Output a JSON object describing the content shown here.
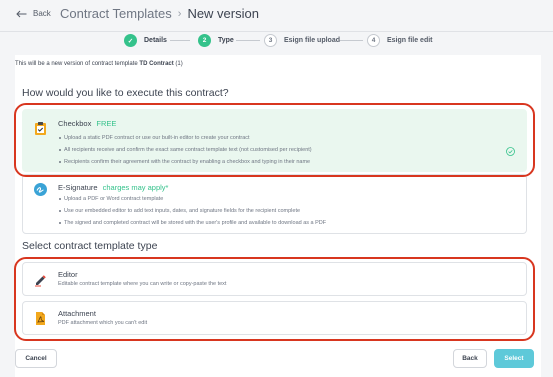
{
  "header": {
    "back_label": "Back",
    "breadcrumb_parent": "Contract Templates",
    "breadcrumb_separator": "›",
    "breadcrumb_current": "New version"
  },
  "stepper": {
    "steps": [
      {
        "number": "✓",
        "label": "Details",
        "state": "done"
      },
      {
        "number": "2",
        "label": "Type",
        "state": "active"
      },
      {
        "number": "3",
        "label": "Esign file upload",
        "state": "todo"
      },
      {
        "number": "4",
        "label": "Esign file edit",
        "state": "todo"
      }
    ]
  },
  "intro": {
    "prefix": "This will be a new version of contract template",
    "template_name": "TD Contract",
    "suffix": "(1)"
  },
  "execute_section": {
    "heading": "How would you like to execute this contract?",
    "options": [
      {
        "title": "Checkbox",
        "tag": "FREE",
        "icon": "checkbox-clipboard-icon",
        "selected": true,
        "bullets": [
          "Upload a static PDF contract or use our built-in editor to create your contract",
          "All recipients receive and confirm the exact same contract template text (not customised per recipient)",
          "Recipients confirm their agreement with the contract by enabling a checkbox and typing in their name"
        ]
      },
      {
        "title": "E-Signature",
        "tag": "charges may apply*",
        "icon": "esignature-icon",
        "selected": false,
        "bullets": [
          "Upload a PDF or Word contract template",
          "Use our embedded editor to add text inputs, dates, and signature fields for the recipient complete",
          "The signed and completed contract will be stored with the user's profile and available to download as a PDF"
        ]
      }
    ]
  },
  "template_section": {
    "heading": "Select contract template type",
    "options": [
      {
        "title": "Editor",
        "subtitle": "Editable contract template where you can write or copy-paste the text",
        "icon": "pen-editor-icon"
      },
      {
        "title": "Attachment",
        "subtitle": "PDF attachment which you can't edit",
        "icon": "pdf-file-icon"
      }
    ]
  },
  "footer": {
    "cancel_label": "Cancel",
    "back_label": "Back",
    "select_label": "Select"
  },
  "colors": {
    "accent_green": "#34c28b",
    "selected_bg": "#eaf7ef",
    "primary_button": "#5ec9d9",
    "highlight_red": "#d8361f"
  }
}
